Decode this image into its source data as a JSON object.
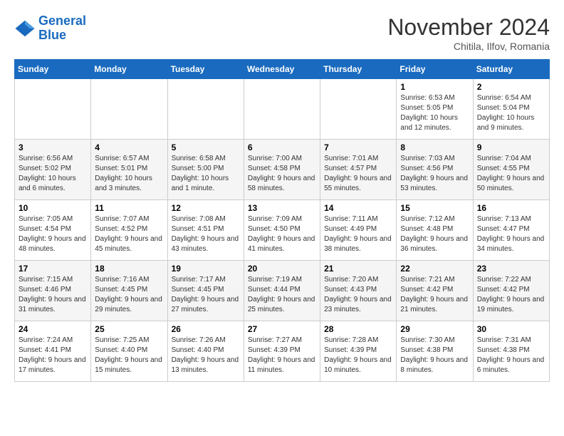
{
  "header": {
    "logo_line1": "General",
    "logo_line2": "Blue",
    "month_title": "November 2024",
    "location": "Chitila, Ilfov, Romania"
  },
  "weekdays": [
    "Sunday",
    "Monday",
    "Tuesday",
    "Wednesday",
    "Thursday",
    "Friday",
    "Saturday"
  ],
  "weeks": [
    [
      {
        "day": "",
        "info": ""
      },
      {
        "day": "",
        "info": ""
      },
      {
        "day": "",
        "info": ""
      },
      {
        "day": "",
        "info": ""
      },
      {
        "day": "",
        "info": ""
      },
      {
        "day": "1",
        "info": "Sunrise: 6:53 AM\nSunset: 5:05 PM\nDaylight: 10 hours and 12 minutes."
      },
      {
        "day": "2",
        "info": "Sunrise: 6:54 AM\nSunset: 5:04 PM\nDaylight: 10 hours and 9 minutes."
      }
    ],
    [
      {
        "day": "3",
        "info": "Sunrise: 6:56 AM\nSunset: 5:02 PM\nDaylight: 10 hours and 6 minutes."
      },
      {
        "day": "4",
        "info": "Sunrise: 6:57 AM\nSunset: 5:01 PM\nDaylight: 10 hours and 3 minutes."
      },
      {
        "day": "5",
        "info": "Sunrise: 6:58 AM\nSunset: 5:00 PM\nDaylight: 10 hours and 1 minute."
      },
      {
        "day": "6",
        "info": "Sunrise: 7:00 AM\nSunset: 4:58 PM\nDaylight: 9 hours and 58 minutes."
      },
      {
        "day": "7",
        "info": "Sunrise: 7:01 AM\nSunset: 4:57 PM\nDaylight: 9 hours and 55 minutes."
      },
      {
        "day": "8",
        "info": "Sunrise: 7:03 AM\nSunset: 4:56 PM\nDaylight: 9 hours and 53 minutes."
      },
      {
        "day": "9",
        "info": "Sunrise: 7:04 AM\nSunset: 4:55 PM\nDaylight: 9 hours and 50 minutes."
      }
    ],
    [
      {
        "day": "10",
        "info": "Sunrise: 7:05 AM\nSunset: 4:54 PM\nDaylight: 9 hours and 48 minutes."
      },
      {
        "day": "11",
        "info": "Sunrise: 7:07 AM\nSunset: 4:52 PM\nDaylight: 9 hours and 45 minutes."
      },
      {
        "day": "12",
        "info": "Sunrise: 7:08 AM\nSunset: 4:51 PM\nDaylight: 9 hours and 43 minutes."
      },
      {
        "day": "13",
        "info": "Sunrise: 7:09 AM\nSunset: 4:50 PM\nDaylight: 9 hours and 41 minutes."
      },
      {
        "day": "14",
        "info": "Sunrise: 7:11 AM\nSunset: 4:49 PM\nDaylight: 9 hours and 38 minutes."
      },
      {
        "day": "15",
        "info": "Sunrise: 7:12 AM\nSunset: 4:48 PM\nDaylight: 9 hours and 36 minutes."
      },
      {
        "day": "16",
        "info": "Sunrise: 7:13 AM\nSunset: 4:47 PM\nDaylight: 9 hours and 34 minutes."
      }
    ],
    [
      {
        "day": "17",
        "info": "Sunrise: 7:15 AM\nSunset: 4:46 PM\nDaylight: 9 hours and 31 minutes."
      },
      {
        "day": "18",
        "info": "Sunrise: 7:16 AM\nSunset: 4:45 PM\nDaylight: 9 hours and 29 minutes."
      },
      {
        "day": "19",
        "info": "Sunrise: 7:17 AM\nSunset: 4:45 PM\nDaylight: 9 hours and 27 minutes."
      },
      {
        "day": "20",
        "info": "Sunrise: 7:19 AM\nSunset: 4:44 PM\nDaylight: 9 hours and 25 minutes."
      },
      {
        "day": "21",
        "info": "Sunrise: 7:20 AM\nSunset: 4:43 PM\nDaylight: 9 hours and 23 minutes."
      },
      {
        "day": "22",
        "info": "Sunrise: 7:21 AM\nSunset: 4:42 PM\nDaylight: 9 hours and 21 minutes."
      },
      {
        "day": "23",
        "info": "Sunrise: 7:22 AM\nSunset: 4:42 PM\nDaylight: 9 hours and 19 minutes."
      }
    ],
    [
      {
        "day": "24",
        "info": "Sunrise: 7:24 AM\nSunset: 4:41 PM\nDaylight: 9 hours and 17 minutes."
      },
      {
        "day": "25",
        "info": "Sunrise: 7:25 AM\nSunset: 4:40 PM\nDaylight: 9 hours and 15 minutes."
      },
      {
        "day": "26",
        "info": "Sunrise: 7:26 AM\nSunset: 4:40 PM\nDaylight: 9 hours and 13 minutes."
      },
      {
        "day": "27",
        "info": "Sunrise: 7:27 AM\nSunset: 4:39 PM\nDaylight: 9 hours and 11 minutes."
      },
      {
        "day": "28",
        "info": "Sunrise: 7:28 AM\nSunset: 4:39 PM\nDaylight: 9 hours and 10 minutes."
      },
      {
        "day": "29",
        "info": "Sunrise: 7:30 AM\nSunset: 4:38 PM\nDaylight: 9 hours and 8 minutes."
      },
      {
        "day": "30",
        "info": "Sunrise: 7:31 AM\nSunset: 4:38 PM\nDaylight: 9 hours and 6 minutes."
      }
    ]
  ],
  "colors": {
    "header_bg": "#1a6bbf",
    "header_text": "#ffffff",
    "row_even_bg": "#f5f5f5",
    "row_odd_bg": "#ffffff"
  }
}
